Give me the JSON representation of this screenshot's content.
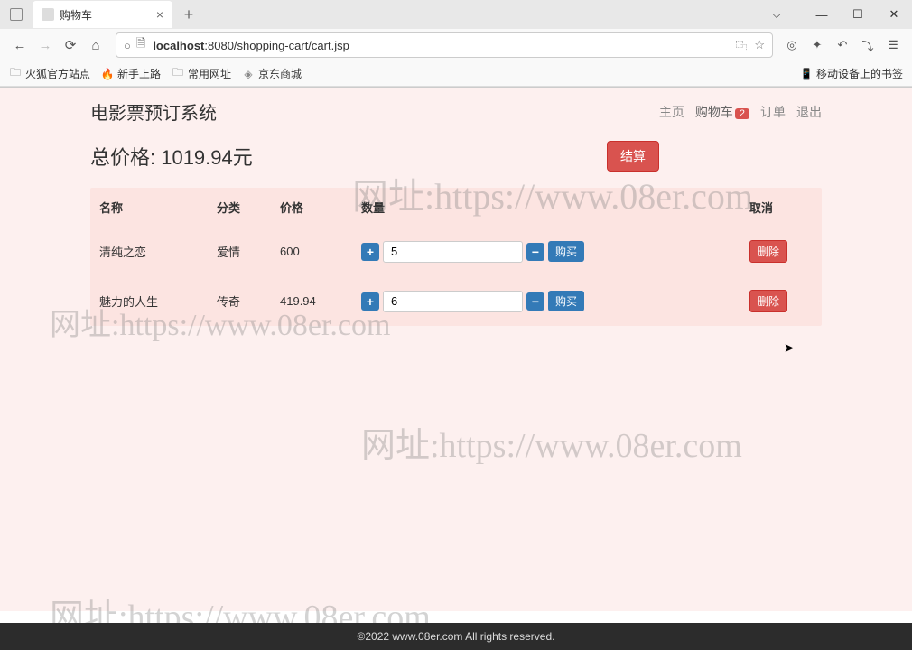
{
  "browser": {
    "tab_title": "购物车",
    "new_tab": "+",
    "tab_close": "×",
    "window_min": "—",
    "window_max": "☐",
    "window_close": "✕",
    "chevron": "⌵",
    "nav_back": "←",
    "nav_forward": "→",
    "nav_refresh": "⟳",
    "nav_home": "⌂",
    "url_shield": "○",
    "url_lock": "🗎",
    "url_host": "localhost",
    "url_port_path": ":8080/shopping-cart/cart.jsp",
    "url_qr": "⿻",
    "url_star": "☆",
    "tb_account": "◎",
    "tb_ext": "✦",
    "tb_undo": "↶",
    "tb_pocket": "⤵",
    "tb_menu": "☰"
  },
  "bookmarks": {
    "b1": "火狐官方站点",
    "b2": "新手上路",
    "b3": "常用网址",
    "b4": "京东商城",
    "right": "移动设备上的书签"
  },
  "header": {
    "title": "电影票预订系统",
    "nav_home": "主页",
    "nav_cart": "购物车",
    "cart_count": "2",
    "nav_order": "订单",
    "nav_logout": "退出"
  },
  "total": {
    "label": "总价格: 1019.94元",
    "checkout": "结算"
  },
  "table": {
    "h_name": "名称",
    "h_cat": "分类",
    "h_price": "价格",
    "h_qty": "数量",
    "h_cancel": "取消",
    "plus": "+",
    "minus": "−",
    "buy": "购买",
    "del": "删除",
    "rows": [
      {
        "name": "清纯之恋",
        "cat": "爱情",
        "price": "600",
        "qty": "5"
      },
      {
        "name": "魅力的人生",
        "cat": "传奇",
        "price": "419.94",
        "qty": "6"
      }
    ]
  },
  "watermark": "网址:https://www.08er.com",
  "footer": "©2022 www.08er.com All rights reserved."
}
